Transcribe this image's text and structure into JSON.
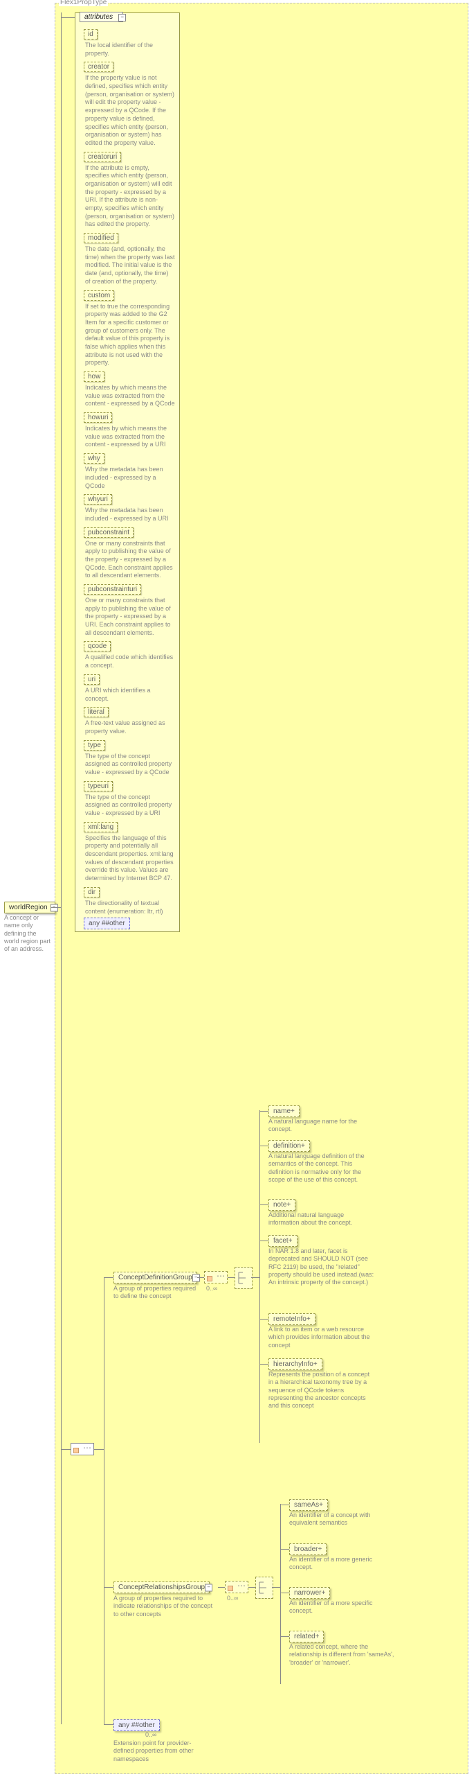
{
  "outer_title": "Flex1PropType",
  "root": {
    "name": "worldRegion",
    "desc": "A concept or name only defining the world region part of an address."
  },
  "attributes_label": "attributes",
  "attributes": [
    {
      "name": "id",
      "desc": "The local identifier of the property."
    },
    {
      "name": "creator",
      "desc": "If the property value is not defined, specifies which entity (person, organisation or system) will edit the property value - expressed by a QCode. If the property value is defined, specifies which entity (person, organisation or system) has edited the property value."
    },
    {
      "name": "creatoruri",
      "desc": "If the attribute is empty, specifies which entity (person, organisation or system) will edit the property - expressed by a URI. If the attribute is non-empty, specifies which entity (person, organisation or system) has edited the property."
    },
    {
      "name": "modified",
      "desc": "The date (and, optionally, the time) when the property was last modified. The initial value is the date (and, optionally, the time) of creation of the property."
    },
    {
      "name": "custom",
      "desc": "If set to true the corresponding property was added to the G2 Item for a specific customer or group of customers only. The default value of this property is false which applies when this attribute is not used with the property."
    },
    {
      "name": "how",
      "desc": "Indicates by which means the value was extracted from the content - expressed by a QCode"
    },
    {
      "name": "howuri",
      "desc": "Indicates by which means the value was extracted from the content - expressed by a URI"
    },
    {
      "name": "why",
      "desc": "Why the metadata has been included - expressed by a QCode"
    },
    {
      "name": "whyuri",
      "desc": "Why the metadata has been included - expressed by a URI"
    },
    {
      "name": "pubconstraint",
      "desc": "One or many constraints that apply to publishing the value of the property - expressed by a QCode. Each constraint applies to all descendant elements."
    },
    {
      "name": "pubconstrainturi",
      "desc": "One or many constraints that apply to publishing the value of the property - expressed by a URI. Each constraint applies to all descendant elements."
    },
    {
      "name": "qcode",
      "desc": "A qualified code which identifies a concept."
    },
    {
      "name": "uri",
      "desc": "A URI which identifies a concept."
    },
    {
      "name": "literal",
      "desc": "A free-text value assigned as property value."
    },
    {
      "name": "type",
      "desc": "The type of the concept assigned as controlled property value - expressed by a QCode"
    },
    {
      "name": "typeuri",
      "desc": "The type of the concept assigned as controlled property value - expressed by a URI"
    },
    {
      "name": "xml:lang",
      "desc": "Specifies the language of this property and potentially all descendant properties. xml:lang values of descendant properties override this value. Values are determined by Internet BCP 47."
    },
    {
      "name": "dir",
      "desc": "The directionality of textual content (enumeration: ltr, rtl)"
    }
  ],
  "attr_any": "any ##other",
  "groups": {
    "def": {
      "label": "ConceptDefinitionGroup",
      "desc": "A group of properties required to define the concept",
      "occ": "0..∞"
    },
    "rel": {
      "label": "ConceptRelationshipsGroup",
      "desc": "A group of properties required to indicate relationships of the concept to other concepts",
      "occ": "0..∞"
    },
    "any": {
      "label": "any ##other",
      "desc": "Extension point for provider-defined properties from other namespaces",
      "occ": "0..∞"
    }
  },
  "def_children": [
    {
      "name": "name",
      "desc": "A natural language name for the concept."
    },
    {
      "name": "definition",
      "desc": "A natural language definition of the semantics of the concept. This definition is normative only for the scope of the use of this concept."
    },
    {
      "name": "note",
      "desc": "Additional natural language information about the concept."
    },
    {
      "name": "facet",
      "desc": "In NAR 1.8 and later, facet is deprecated and SHOULD NOT (see RFC 2119) be used, the \"related\" property should be used instead.(was: An intrinsic property of the concept.)"
    },
    {
      "name": "remoteInfo",
      "desc": "A link to an item or a web resource which provides information about the concept"
    },
    {
      "name": "hierarchyInfo",
      "desc": "Represents the position of a concept in a hierarchical taxonomy tree by a sequence of QCode tokens representing the ancestor concepts and this concept"
    }
  ],
  "rel_children": [
    {
      "name": "sameAs",
      "desc": "An identifier of a concept with equivalent semantics"
    },
    {
      "name": "broader",
      "desc": "An identifier of a more generic concept."
    },
    {
      "name": "narrower",
      "desc": "An identifier of a more specific concept."
    },
    {
      "name": "related",
      "desc": "A related concept, where the relationship is different from 'sameAs', 'broader' or 'narrower'."
    }
  ]
}
